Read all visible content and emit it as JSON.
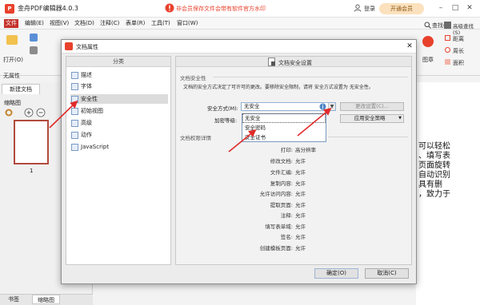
{
  "app": {
    "title": "金舟PDF编辑器4.0.3",
    "notice": "非会员保存文件会带有软件官方水印",
    "login": "登录",
    "vip": "开通会员"
  },
  "menu": [
    "文件",
    "编辑(E)",
    "视图(V)",
    "文档(D)",
    "注释(C)",
    "表单(R)",
    "工具(T)",
    "窗口(W)"
  ],
  "ribbon": {
    "open": "打开(O)",
    "no_property": "无属性",
    "find": "查找(F)",
    "advanced_find": "高级查找(S)",
    "stamp": "图章",
    "distance": "距离",
    "perimeter": "周长",
    "area": "面积"
  },
  "left_pane": {
    "tab": "新建文档",
    "thumbnails": "缩略图",
    "page_number": "1",
    "bottom_tabs": [
      "书签",
      "缩略图"
    ]
  },
  "doc_text": [
    "可以轻松",
    "、填写表",
    "页面旋转",
    "自动识别",
    "具有删",
    "，致力于"
  ],
  "dialog": {
    "title": "文档属性",
    "category_header": "分类",
    "categories": [
      "描述",
      "字体",
      "安全性",
      "初始视图",
      "高级",
      "动作",
      "JavaScript"
    ],
    "selected_category": "安全性",
    "panel_title": "文档安全设置",
    "security_group": "文档安全性",
    "description": "文档的安全方式决定了可许可的更改。要移除安全限制，请将 安全方式设置为 无安全性。",
    "security_method_label": "安全方式(M):",
    "security_method_value": "无安全",
    "encryption_label": "加密等级:",
    "change_settings": "更改设置(C)...",
    "apply_policy": "应用安全策略",
    "dropdown_options": [
      "无安全",
      "安全密码",
      "安全证书"
    ],
    "permissions_group": "文档权限详情",
    "permissions": [
      {
        "label": "打印:",
        "value": "高分辨率"
      },
      {
        "label": "修改文档:",
        "value": "允许"
      },
      {
        "label": "文件汇编:",
        "value": "允许"
      },
      {
        "label": "复制内容:",
        "value": "允许"
      },
      {
        "label": "允许访问内容:",
        "value": "允许"
      },
      {
        "label": "提取页面:",
        "value": "允许"
      },
      {
        "label": "注释:",
        "value": "允许"
      },
      {
        "label": "填写表单域:",
        "value": "允许"
      },
      {
        "label": "签名:",
        "value": "允许"
      },
      {
        "label": "创建模板页面:",
        "value": "允许"
      }
    ],
    "ok": "确定(O)",
    "cancel": "取消(C)"
  },
  "colors": {
    "accent": "#c4332c",
    "arrow": "#e02b2b",
    "brand": "#e8412c"
  }
}
